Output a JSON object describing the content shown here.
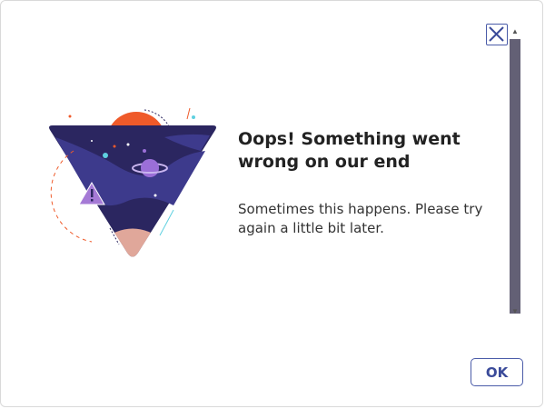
{
  "dialog": {
    "title": "Oops! Something went wrong on our end",
    "message": "Sometimes this happens. Please try again a little bit later.",
    "ok_label": "OK",
    "close_icon": "close-icon"
  },
  "illustration": {
    "icon": "warning-icon",
    "colors": {
      "sky": "#2b2660",
      "nebula": "#3d3a8c",
      "sun": "#ef5a2a",
      "planet": "#9b6fd8",
      "ground": "#e0a79a",
      "warning": "#a57ad6"
    }
  },
  "colors": {
    "accent": "#4a5ba8",
    "scroll_thumb": "#636075"
  }
}
